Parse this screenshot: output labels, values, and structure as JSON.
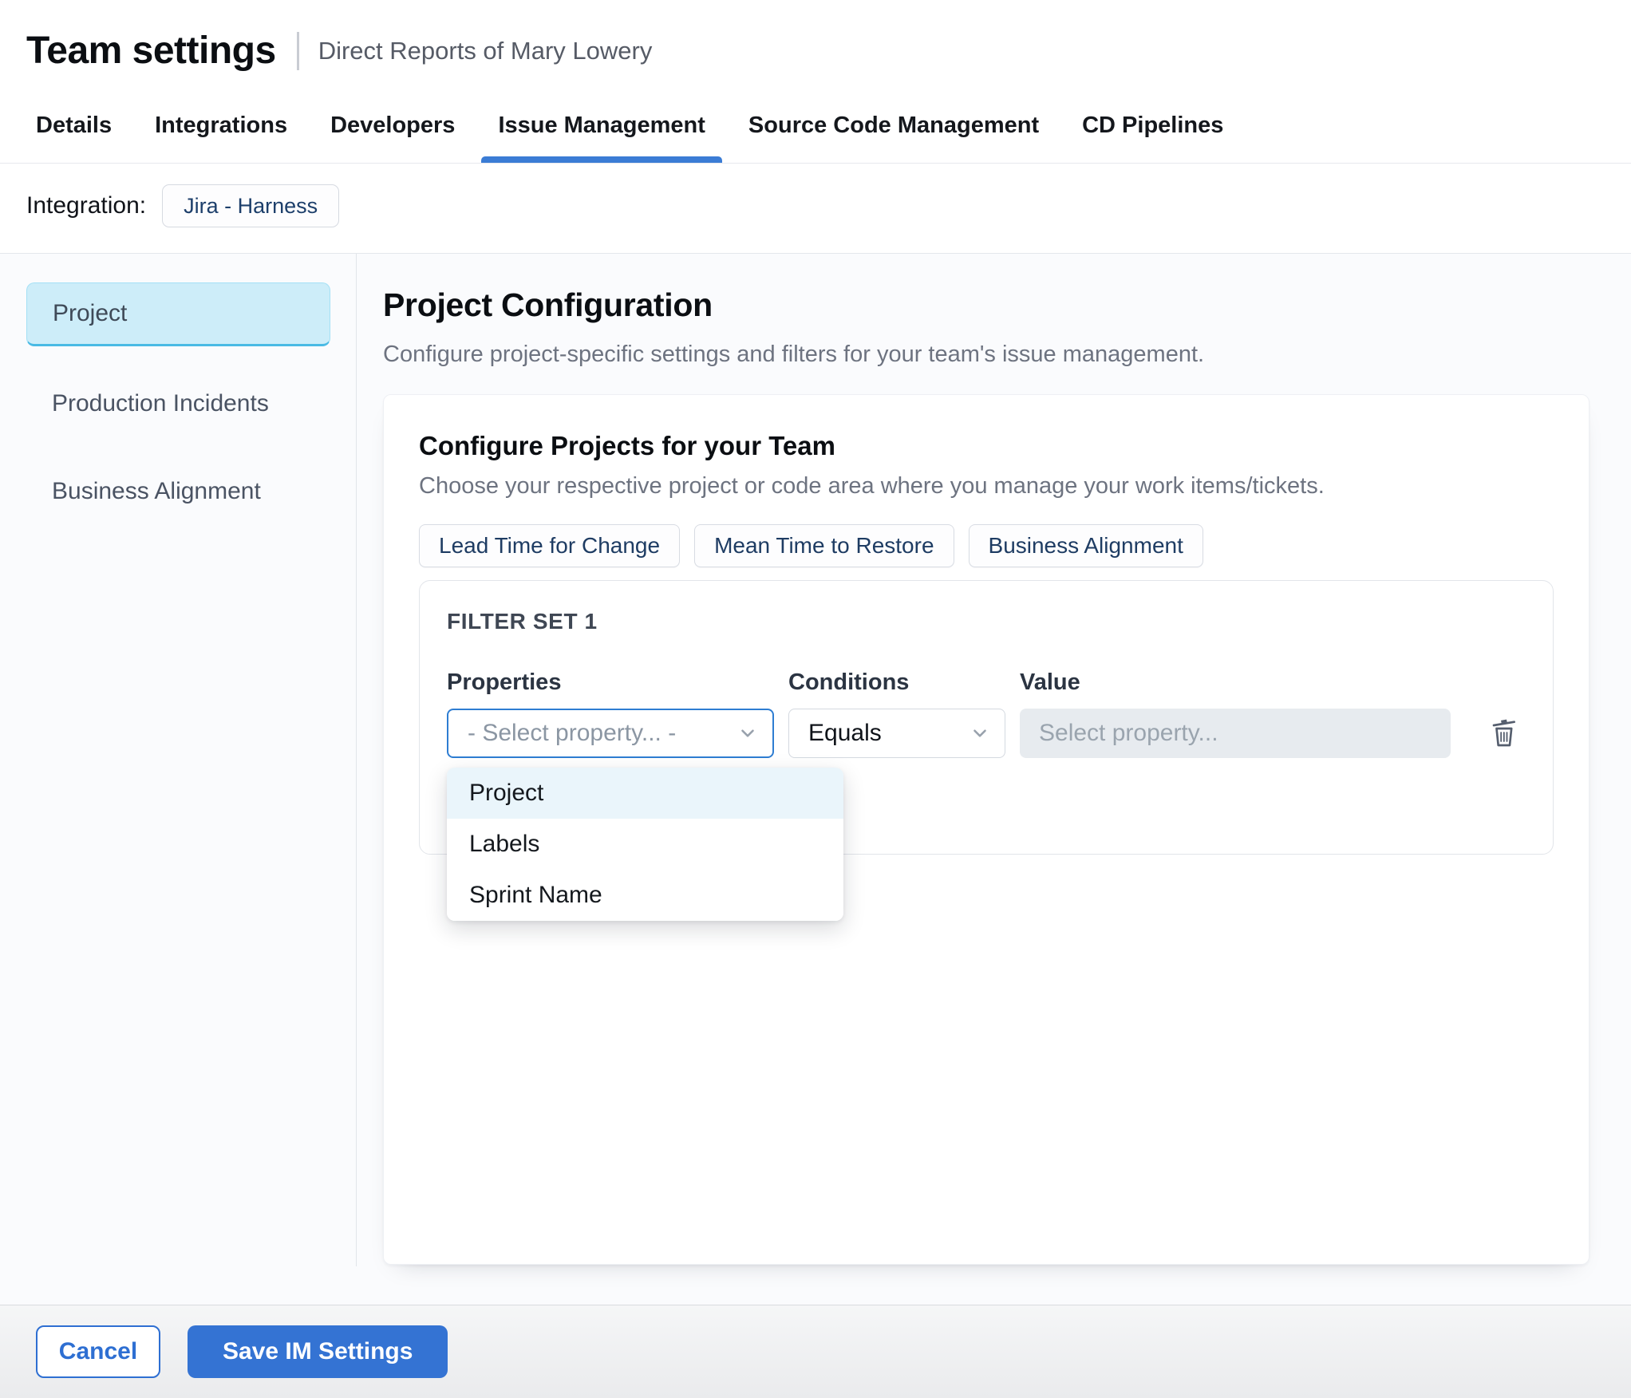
{
  "header": {
    "title": "Team settings",
    "subtitle": "Direct Reports of Mary Lowery"
  },
  "tabs": [
    {
      "label": "Details",
      "active": false
    },
    {
      "label": "Integrations",
      "active": false
    },
    {
      "label": "Developers",
      "active": false
    },
    {
      "label": "Issue Management",
      "active": true
    },
    {
      "label": "Source Code Management",
      "active": false
    },
    {
      "label": "CD Pipelines",
      "active": false
    }
  ],
  "integration": {
    "label": "Integration:",
    "chip": "Jira - Harness"
  },
  "sidebar": {
    "items": [
      {
        "label": "Project",
        "selected": true
      },
      {
        "label": "Production Incidents",
        "selected": false
      },
      {
        "label": "Business Alignment",
        "selected": false
      }
    ]
  },
  "main": {
    "title": "Project Configuration",
    "subtitle": "Configure project-specific settings and filters for your team's issue management.",
    "card": {
      "title": "Configure Projects for your Team",
      "subtitle": "Choose your respective project or code area where you manage your work items/tickets.",
      "pills": [
        {
          "label": "Lead Time for Change"
        },
        {
          "label": "Mean Time to Restore"
        },
        {
          "label": "Business Alignment"
        }
      ],
      "filter_set": {
        "title": "FILTER SET 1",
        "columns": {
          "properties": "Properties",
          "conditions": "Conditions",
          "value": "Value"
        },
        "properties_selected": "- Select property... -",
        "conditions_selected": "Equals",
        "value_placeholder": "Select property...",
        "dropdown_options": [
          {
            "label": "Project",
            "highlighted": true
          },
          {
            "label": "Labels",
            "highlighted": false
          },
          {
            "label": "Sprint Name",
            "highlighted": false
          }
        ]
      }
    }
  },
  "footer": {
    "cancel_label": "Cancel",
    "save_label": "Save IM Settings"
  },
  "colors": {
    "accent_blue": "#3473d3",
    "tab_underline_blue": "#3b7cd5",
    "focus_border_blue": "#2e7dd2",
    "chip_text_navy": "#1d3f6b",
    "selected_item_bg": "#cdedf9",
    "selected_item_border": "#49bae4",
    "dropdown_highlight": "#eaf5fb",
    "disabled_input_bg": "#e7ebef"
  }
}
